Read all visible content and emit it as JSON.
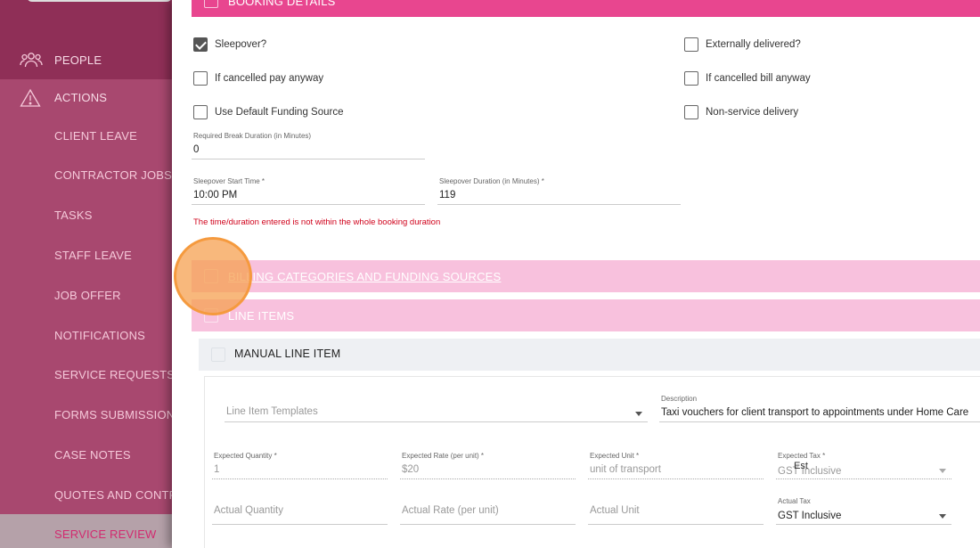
{
  "sidebar": {
    "items": [
      {
        "label": "PEOPLE",
        "icon": "people-icon"
      },
      {
        "label": "ACTIONS",
        "icon": "warning-icon"
      },
      {
        "label": "CLIENT LEAVE"
      },
      {
        "label": "CONTRACTOR JOBS"
      },
      {
        "label": "TASKS"
      },
      {
        "label": "STAFF LEAVE"
      },
      {
        "label": "JOB OFFER"
      },
      {
        "label": "NOTIFICATIONS"
      },
      {
        "label": "SERVICE REQUESTS"
      },
      {
        "label": "FORMS SUBMISSIONS"
      },
      {
        "label": "CASE NOTES"
      },
      {
        "label": "QUOTES AND CONTRA"
      },
      {
        "label": "SERVICE REVIEW",
        "active": true
      }
    ]
  },
  "sections": {
    "booking_details": "BOOKING DETAILS",
    "billing": "BILLING CATEGORIES AND FUNDING SOURCES",
    "line_items": "LINE ITEMS",
    "manual_line_item": "MANUAL LINE ITEM"
  },
  "checkboxes": {
    "sleepover": {
      "label": "Sleepover?",
      "checked": true
    },
    "externally_delivered": {
      "label": "Externally delivered?",
      "checked": false
    },
    "cancelled_pay": {
      "label": "If cancelled pay anyway",
      "checked": false
    },
    "cancelled_bill": {
      "label": "If cancelled bill anyway",
      "checked": false
    },
    "default_funding": {
      "label": "Use Default Funding Source",
      "checked": false
    },
    "non_service": {
      "label": "Non-service delivery",
      "checked": false
    }
  },
  "fields": {
    "break_duration": {
      "label": "Required Break Duration (in Minutes)",
      "value": "0"
    },
    "sleepover_start": {
      "label": "Sleepover Start Time *",
      "value": "10:00 PM"
    },
    "sleepover_duration": {
      "label": "Sleepover Duration (in Minutes) *",
      "value": "119"
    },
    "error": "The time/duration entered is not within the whole booking duration"
  },
  "line_item": {
    "templates_placeholder": "Line Item Templates",
    "description_label": "Description",
    "description_value": "Taxi vouchers for client transport to appointments under Home Care",
    "expected_quantity_label": "Expected Quantity *",
    "expected_quantity_value": "1",
    "expected_rate_label": "Expected Rate (per unit) *",
    "expected_rate_value": "$20",
    "expected_unit_label": "Expected Unit *",
    "expected_unit_value": "unit of transport",
    "expected_tax_label": "Expected Tax *",
    "expected_tax_value": "GST Inclusive",
    "est_label": "Est",
    "actual_quantity_placeholder": "Actual Quantity",
    "actual_rate_placeholder": "Actual Rate (per unit)",
    "actual_unit_placeholder": "Actual Unit",
    "actual_tax_label": "Actual Tax",
    "actual_tax_value": "GST Inclusive"
  },
  "colors": {
    "sidebar": "#a8486f",
    "section_dark": "#e8468f",
    "section_light": "#f8c1dd",
    "error": "#d0021b",
    "click_highlight": "#f59a3e"
  }
}
